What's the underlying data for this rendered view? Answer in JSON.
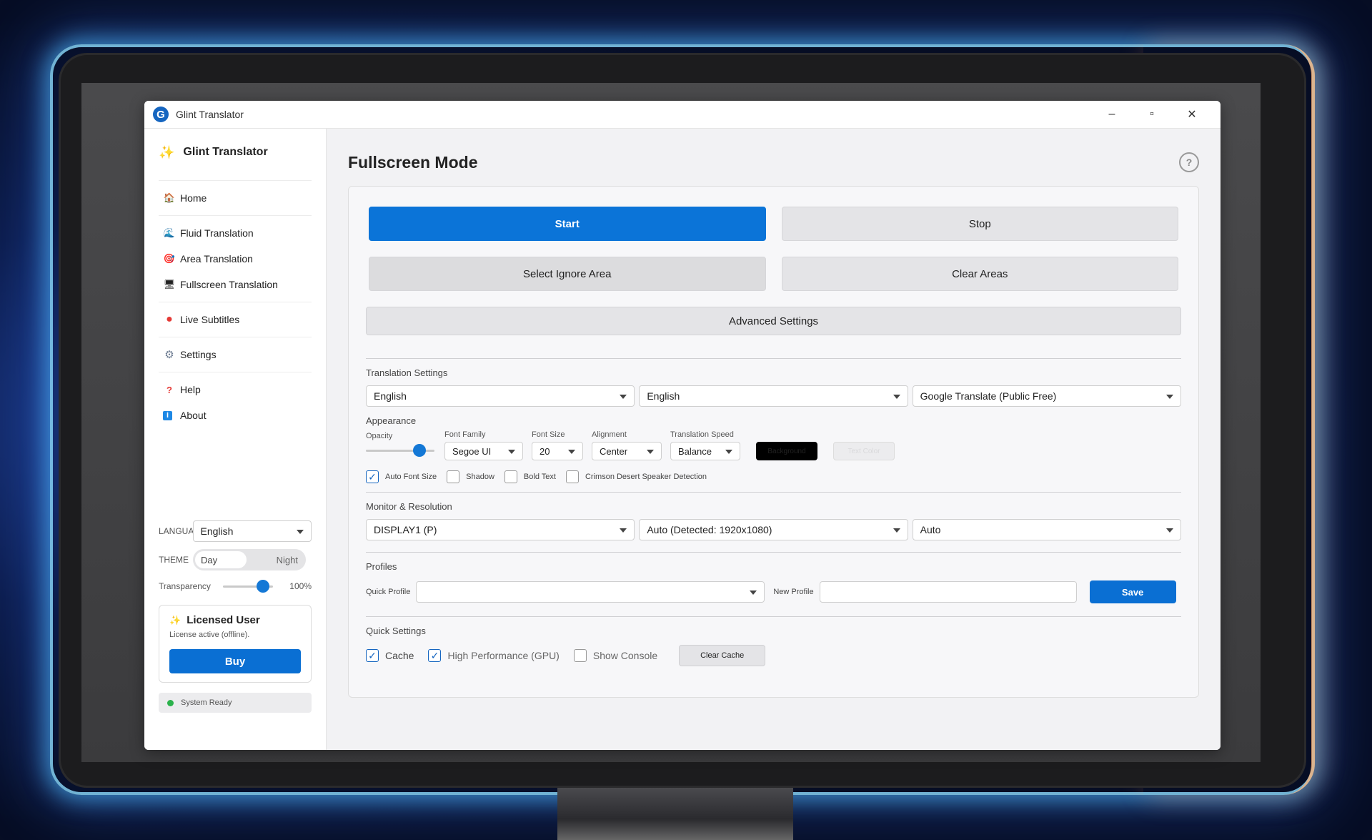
{
  "window": {
    "title": "Glint Translator",
    "app_logo_letter": "G",
    "minimize": "–",
    "maximize": "▫",
    "close": "✕"
  },
  "sidebar": {
    "app_name": "Glint Translator",
    "nav": [
      {
        "label": "Home",
        "icon": "home-icon",
        "glyph": "🏠"
      },
      {
        "label": "Fluid Translation",
        "icon": "wave-icon",
        "glyph": "🌊"
      },
      {
        "label": "Area Translation",
        "icon": "target-icon",
        "glyph": "🎯"
      },
      {
        "label": "Fullscreen Translation",
        "icon": "monitor-icon",
        "glyph": "🖥"
      },
      {
        "label": "Live Subtitles",
        "icon": "red-dot-icon",
        "glyph": "●"
      },
      {
        "label": "Settings",
        "icon": "gear-icon",
        "glyph": "⚙"
      },
      {
        "label": "Help",
        "icon": "question-icon",
        "glyph": "?"
      },
      {
        "label": "About",
        "icon": "info-icon",
        "glyph": "i"
      }
    ],
    "language_label": "LANGUA",
    "language_value": "English",
    "theme_label": "THEME",
    "theme_day": "Day",
    "theme_night": "Night",
    "theme_selected": "Day",
    "transparency_label": "Transparency",
    "transparency_value": "100%",
    "transparency_level": 0.9,
    "license_title": "Licensed User",
    "license_sub": "License active (offline).",
    "buy_label": "Buy",
    "status_text": "System Ready"
  },
  "main": {
    "title": "Fullscreen Mode",
    "help_glyph": "?",
    "start_label": "Start",
    "stop_label": "Stop",
    "ignore_label": "Select Ignore Area",
    "clear_areas_label": "Clear Areas",
    "advanced_label": "Advanced Settings",
    "translation": {
      "title": "Translation Settings",
      "source": "English",
      "target": "English",
      "engine": "Google Translate (Public Free)"
    },
    "appearance": {
      "title": "Appearance",
      "opacity_label": "Opacity",
      "opacity_level": 0.85,
      "font_family_label": "Font Family",
      "font_family": "Segoe UI",
      "font_size_label": "Font Size",
      "font_size": "20",
      "alignment_label": "Alignment",
      "alignment": "Center",
      "speed_label": "Translation Speed",
      "speed": "Balance",
      "background_btn": "Background",
      "text_color_btn": "Text Color",
      "checks": [
        {
          "label": "Auto Font Size",
          "checked": true
        },
        {
          "label": "Shadow",
          "checked": false
        },
        {
          "label": "Bold Text",
          "checked": false
        },
        {
          "label": "Crimson Desert Speaker Detection",
          "checked": false
        }
      ]
    },
    "monitor": {
      "title": "Monitor & Resolution",
      "display": "DISPLAY1 (P)",
      "resolution": "Auto (Detected: 1920x1080)",
      "mode": "Auto"
    },
    "profiles": {
      "title": "Profiles",
      "quick_label": "Quick Profile",
      "quick_value": "",
      "new_label": "New Profile",
      "new_value": "",
      "save_label": "Save"
    },
    "quick": {
      "title": "Quick Settings",
      "items": [
        {
          "label": "Cache",
          "checked": true
        },
        {
          "label": "High Performance (GPU)",
          "checked": true
        },
        {
          "label": "Show Console",
          "checked": false
        }
      ],
      "clear_cache_label": "Clear Cache"
    }
  }
}
